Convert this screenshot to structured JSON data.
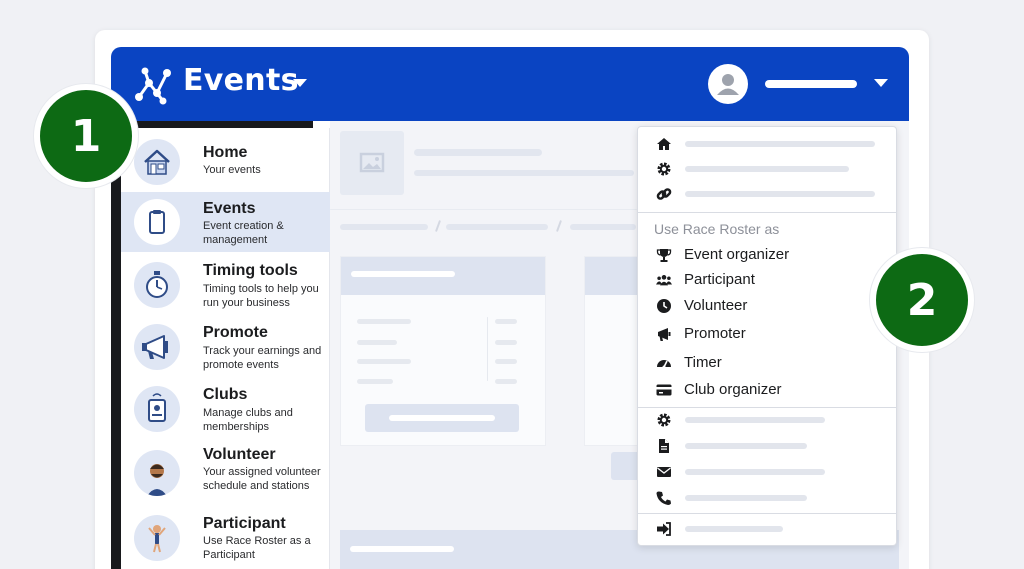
{
  "app": {
    "title": "Events"
  },
  "menu": {
    "items": [
      {
        "title": "Home",
        "desc": "Your events"
      },
      {
        "title": "Events",
        "desc": "Event creation & management"
      },
      {
        "title": "Timing tools",
        "desc": "Timing tools to help you run your business"
      },
      {
        "title": "Promote",
        "desc": "Track your earnings and promote events"
      },
      {
        "title": "Clubs",
        "desc": "Manage clubs and memberships"
      },
      {
        "title": "Volunteer",
        "desc": "Your assigned volunteer schedule and stations"
      },
      {
        "title": "Participant",
        "desc": "Use Race Roster as a Participant"
      }
    ]
  },
  "dropdown": {
    "section_label": "Use Race Roster as",
    "roles": [
      "Event organizer",
      "Participant",
      "Volunteer",
      "Promoter",
      "Timer",
      "Club organizer"
    ]
  },
  "badges": {
    "first": "1",
    "second": "2"
  },
  "colors": {
    "brand_blue": "#0a44c2",
    "badge_green": "#0d6a14",
    "active_row": "#dfe6f4"
  },
  "icons": {
    "header": [
      "events-logo-icon",
      "caret-down-icon",
      "user-avatar-icon"
    ],
    "dropdown_top": [
      "home-icon",
      "gear-icon",
      "link-icon"
    ],
    "roles": [
      "trophy-icon",
      "users-icon",
      "clock-icon",
      "megaphone-icon",
      "speedometer-icon",
      "credit-card-icon"
    ],
    "dropdown_bottom": [
      "gear-icon",
      "document-icon",
      "envelope-icon",
      "phone-icon",
      "sign-out-icon"
    ]
  }
}
